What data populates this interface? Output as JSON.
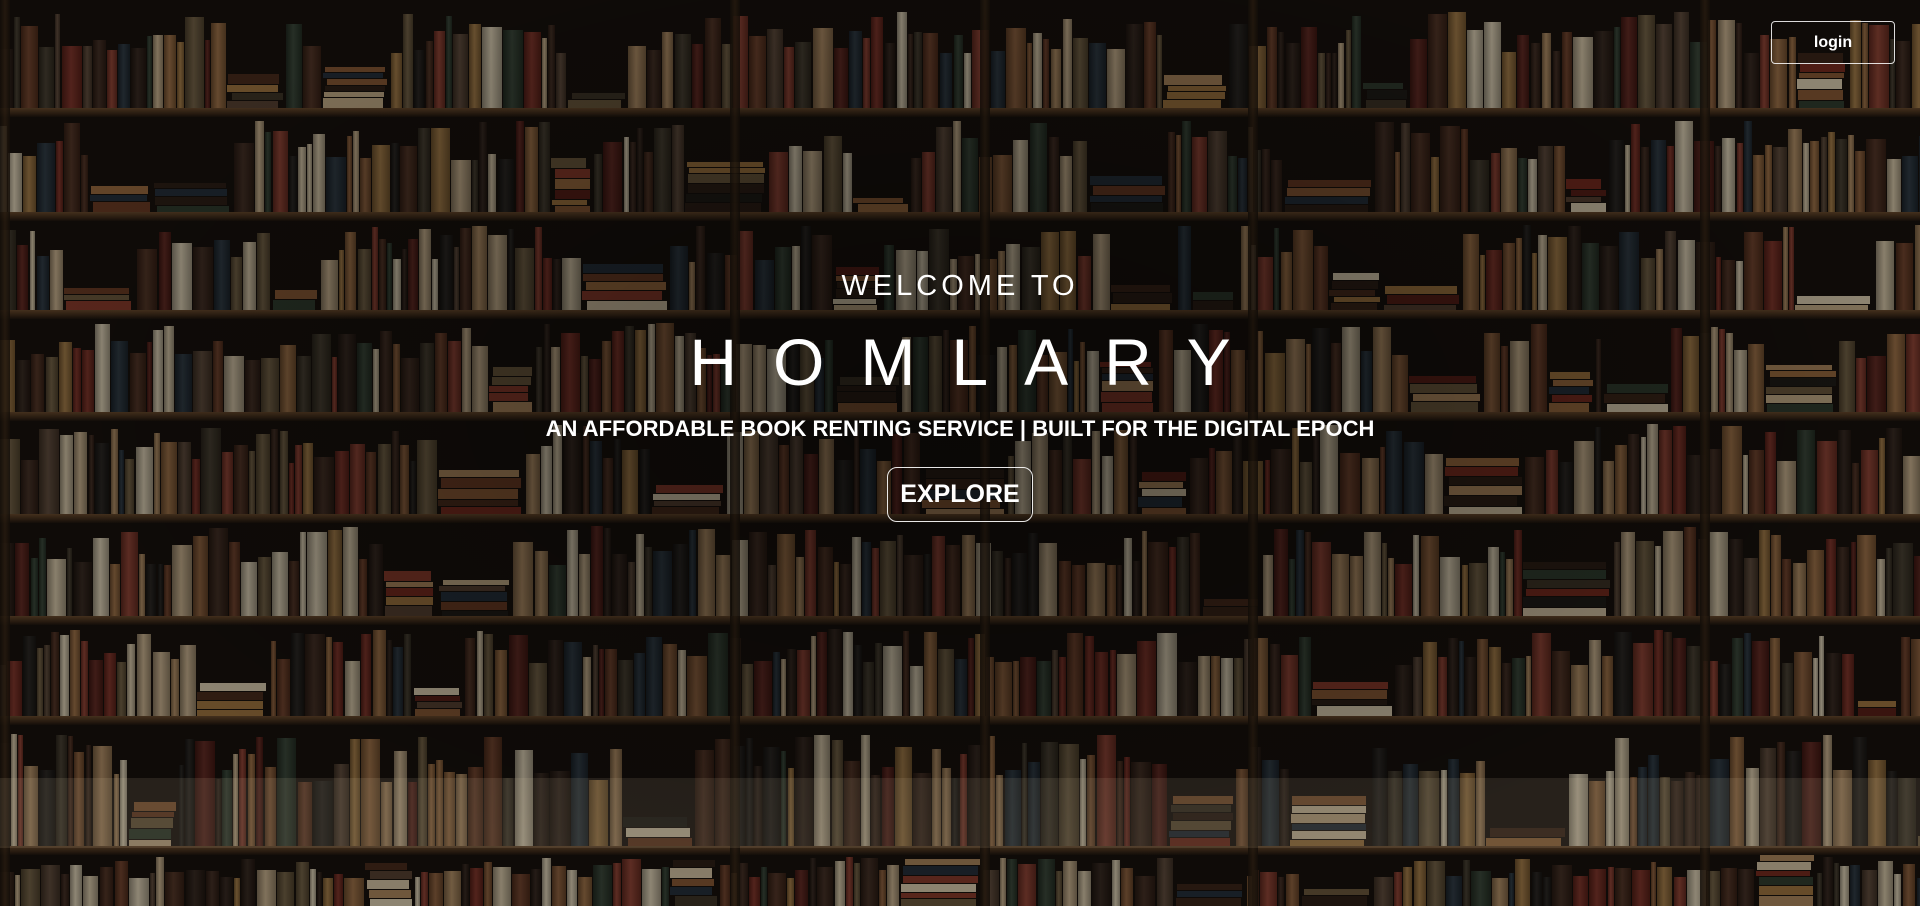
{
  "header": {
    "login_label": "login"
  },
  "hero": {
    "welcome": "WELCOME TO",
    "brand": "HOMLARY",
    "tagline": "AN AFFORDABLE BOOK RENTING SERVICE | BUILT FOR THE DIGITAL EPOCH",
    "explore_label": "EXPLORE"
  },
  "colors": {
    "text": "#ffffff",
    "button_border": "#ffffff",
    "shelf_wood": "#5a3d22",
    "background_dark": "#0c0a08"
  },
  "background": {
    "description_icon": "bookshelf-background"
  }
}
